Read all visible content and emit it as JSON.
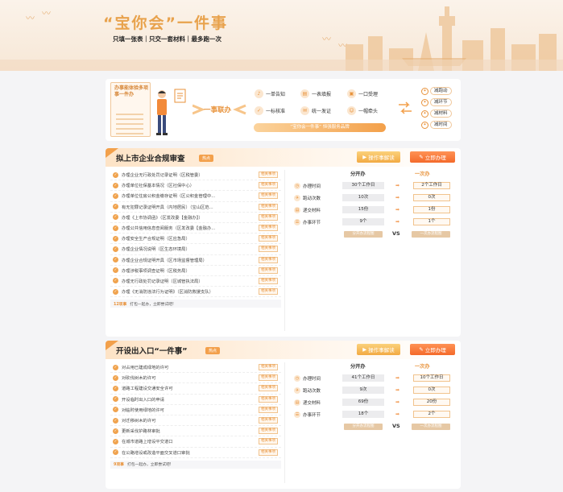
{
  "hero": {
    "title": "“宝你会”一件事",
    "subtitle": "只填一张表｜只交一套材料｜最多跑一次"
  },
  "intro": {
    "note_title": "办事能体验多项事一件办",
    "core_label": "一事联办",
    "features": [
      {
        "icon": "bell-icon",
        "label": "一单告知"
      },
      {
        "icon": "form-icon",
        "label": "一表填报"
      },
      {
        "icon": "window-icon",
        "label": "一口受理"
      },
      {
        "icon": "standard-icon",
        "label": "一标核准"
      },
      {
        "icon": "certificate-icon",
        "label": "统一发证"
      },
      {
        "icon": "person-icon",
        "label": "一帽牵头"
      }
    ],
    "bar_text": "“宝你会一件事” 恒强服务品牌",
    "benefits": [
      "减跑动",
      "减环节",
      "减材料",
      "减时间"
    ]
  },
  "buttons": {
    "intro_video": "操作事解读",
    "apply_now": "立即办理"
  },
  "compare": {
    "left_head": "分开办",
    "right_head": "一次办",
    "vs": "VS",
    "left_foot": "分开办流程图",
    "right_foot": "一次办流程图",
    "metrics": [
      {
        "icon": "clock-icon",
        "label": "办理时间"
      },
      {
        "icon": "run-icon",
        "label": "跑动次数"
      },
      {
        "icon": "doc-icon",
        "label": "递交材料"
      },
      {
        "icon": "step-icon",
        "label": "办事环节"
      }
    ]
  },
  "sections": [
    {
      "title": "拟上市企业合规审查",
      "tag": "热点",
      "link_label": "相关事项",
      "items": [
        "办理企业无行政处罚记录证明（区税管委）",
        "办理单位社保基本情况（区社保中心）",
        "办理单位住房公积金缴存证明（区公积金管理中...",
        "有无犯罪记录证明开具（内地居民）（宝山区范...",
        "办理《上市协调函》（区发改委【金融办】）",
        "办理公共信用信息查阅服务（区发改委【金融办...",
        "办理安全生产合规证明（区应急局）",
        "办理企业情况说明（区生态环境局）",
        "办理企业合规证明开具（区市场监督管理局）",
        "办理涉税事项调查证明（区税务局）",
        "办理无行政处罚记录证明（区城管执法局）",
        "办理《无消防违法行为证明》（区消防救援支队）"
      ],
      "foot_count": "12项事",
      "foot_text": "打包一起办，立即尝试吧!",
      "values": {
        "time_split": "30个工作日",
        "time_once": "2个工作日",
        "runs_split": "10次",
        "runs_once": "0次",
        "docs_split": "15份",
        "docs_once": "1份",
        "steps_split": "9个",
        "steps_once": "1个"
      }
    },
    {
      "title": "开设出入口“一件事”",
      "tag": "热点",
      "link_label": "相关事项",
      "items": [
        "对占用已建成绿地的许可",
        "对砍伐树木的许可",
        "道路工程建设交通安全许可",
        "开设临时出入口的申请",
        "对临时使用绿地的许可",
        "对迁移树木的许可",
        "更新采伐护路林审批",
        "在城市道路上增设平交道口",
        "在公路增设或改造平面交叉道口审批"
      ],
      "foot_count": "9项事",
      "foot_text": "打包一起办，立即尝试吧!",
      "values": {
        "time_split": "41个工作日",
        "time_once": "10个工作日",
        "runs_split": "9次",
        "runs_once": "0次",
        "docs_split": "69份",
        "docs_once": "20份",
        "steps_split": "18个",
        "steps_once": "2个"
      }
    }
  ]
}
